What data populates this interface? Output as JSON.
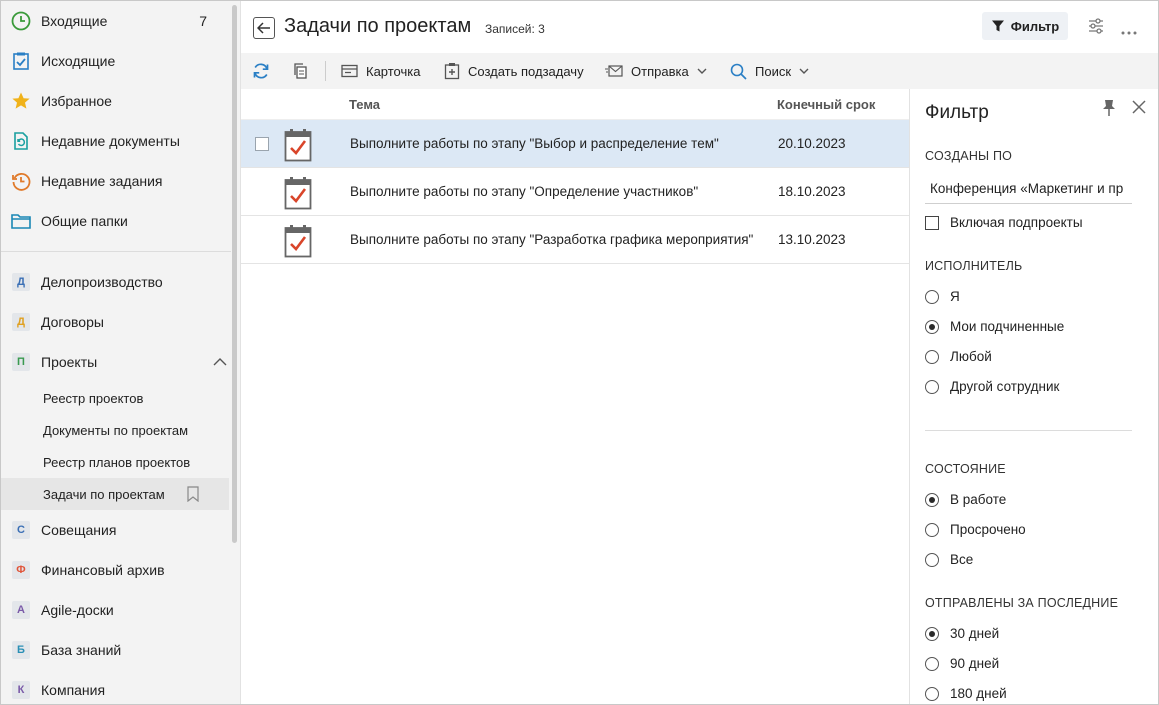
{
  "sidebar": {
    "top_items": [
      {
        "label": "Входящие",
        "icon": "clock-green-icon",
        "count": "7"
      },
      {
        "label": "Исходящие",
        "icon": "checklist-icon"
      },
      {
        "label": "Избранное",
        "icon": "star-icon"
      },
      {
        "label": "Недавние документы",
        "icon": "recent-document-icon"
      },
      {
        "label": "Недавние задания",
        "icon": "recent-tasks-icon"
      },
      {
        "label": "Общие папки",
        "icon": "folder-icon"
      }
    ],
    "sections": [
      {
        "letter": "Д",
        "label": "Делопроизводство",
        "color": "#3a6fb5"
      },
      {
        "letter": "Д",
        "label": "Договоры",
        "color": "#e0a020"
      },
      {
        "letter": "П",
        "label": "Проекты",
        "color": "#3a9a50"
      }
    ],
    "project_subitems": [
      {
        "label": "Реестр проектов"
      },
      {
        "label": "Документы по проектам"
      },
      {
        "label": "Реестр планов проектов"
      },
      {
        "label": "Задачи по проектам"
      }
    ],
    "more_sections": [
      {
        "letter": "С",
        "label": "Совещания",
        "color": "#3a6fb5"
      },
      {
        "letter": "Ф",
        "label": "Финансовый архив",
        "color": "#e0553a"
      },
      {
        "letter": "A",
        "label": "Agile-доски",
        "color": "#7a5aa8"
      },
      {
        "letter": "Б",
        "label": "База знаний",
        "color": "#2a8fb5"
      },
      {
        "letter": "К",
        "label": "Компания",
        "color": "#7a5aa8"
      }
    ]
  },
  "header": {
    "title": "Задачи по проектам",
    "records": "Записей: 3",
    "filter_label": "Фильтр"
  },
  "toolbar": {
    "card": "Карточка",
    "create_subtask": "Создать подзадачу",
    "send": "Отправка",
    "search": "Поиск"
  },
  "table": {
    "columns": {
      "subject": "Тема",
      "due": "Конечный срок"
    },
    "rows": [
      {
        "subject": "Выполните работы по этапу \"Выбор и распределение тем\"",
        "due": "20.10.2023"
      },
      {
        "subject": "Выполните работы по этапу \"Определение участников\"",
        "due": "18.10.2023"
      },
      {
        "subject": "Выполните работы по этапу \"Разработка графика мероприятия\"",
        "due": "13.10.2023"
      }
    ]
  },
  "filter_panel": {
    "title": "Фильтр",
    "created_in": {
      "title": "СОЗДАНЫ ПО",
      "value": "Конференция «Маркетинг и пр",
      "include_subprojects": "Включая подпроекты"
    },
    "executor": {
      "title": "ИСПОЛНИТЕЛЬ",
      "options": [
        "Я",
        "Мои подчиненные",
        "Любой",
        "Другой сотрудник"
      ],
      "selected": 1
    },
    "state": {
      "title": "СОСТОЯНИЕ",
      "options": [
        "В работе",
        "Просрочено",
        "Все"
      ],
      "selected": 0
    },
    "sent": {
      "title": "ОТПРАВЛЕНЫ ЗА ПОСЛЕДНИЕ",
      "options": [
        "30 дней",
        "90 дней",
        "180 дней"
      ],
      "selected": 0
    }
  }
}
